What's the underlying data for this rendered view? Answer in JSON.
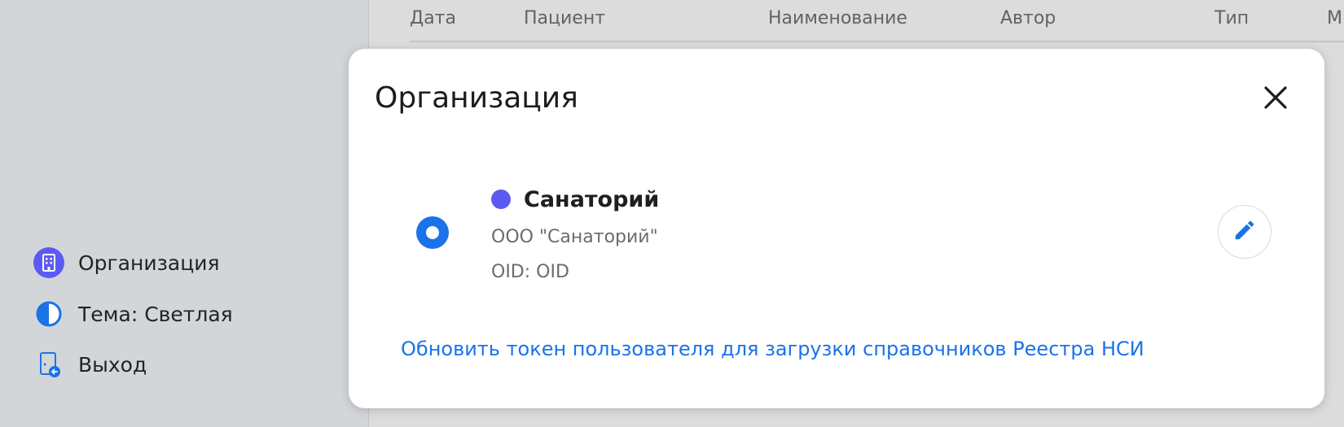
{
  "sidebar": {
    "items": [
      {
        "label": "Организация",
        "icon": "building-icon"
      },
      {
        "label": "Тема: Светлая",
        "icon": "half-circle-theme-icon"
      },
      {
        "label": "Выход",
        "icon": "logout-icon"
      }
    ]
  },
  "table": {
    "headers": [
      "Дата",
      "Пациент",
      "Наименование",
      "Автор",
      "Тип",
      "М"
    ]
  },
  "dialog": {
    "title": "Организация",
    "close_icon": "close-icon",
    "organization": {
      "name": "Санаторий",
      "full_name": "ООО \"Санаторий\"",
      "oid": "OID: OID",
      "color": "#5b5bf4",
      "selected": true
    },
    "edit_icon": "pencil-icon",
    "update_link": "Обновить токен пользователя для загрузки справочников Реестра НСИ"
  },
  "colors": {
    "accent": "#1a73e8",
    "org_indicator": "#5b5bf4",
    "overlay_bg": "#d3d6d9"
  }
}
